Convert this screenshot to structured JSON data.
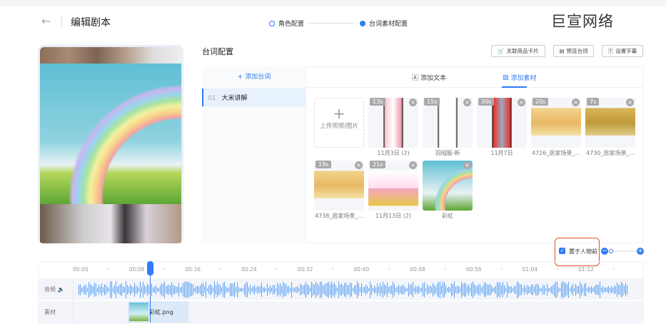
{
  "header": {
    "back_icon": "arrow-left-icon",
    "title": "编辑剧本",
    "steps": [
      "角色配置",
      "台词素材配置"
    ],
    "active_step": 1,
    "watermark": "巨宣网络"
  },
  "config": {
    "title": "台词配置",
    "buttons": [
      "关联商品卡片",
      "预览台词",
      "设置字幕"
    ],
    "add_line": "+ 添加台词",
    "tabs": [
      "添加文本",
      "添加素材"
    ],
    "active_tab": 1,
    "lines": [
      {
        "num": "01",
        "text": "大米讲解"
      }
    ],
    "upload_label": "上传视频/图片",
    "materials": [
      {
        "duration": "13s",
        "name": "11月3日 (2)",
        "thumb": "phone-pink"
      },
      {
        "duration": "15s",
        "name": "羽绒服-新",
        "thumb": "phone-blank"
      },
      {
        "duration": "30s",
        "name": "11月7日",
        "thumb": "phone-red"
      },
      {
        "duration": "20s",
        "name": "4726_居家场景_...",
        "thumb": "durian-flesh"
      },
      {
        "duration": "7s",
        "name": "4730_居家场景_...",
        "thumb": "durian"
      },
      {
        "duration": "19s",
        "name": "4738_居家场景_...",
        "thumb": "durian-flesh"
      },
      {
        "duration": "21s",
        "name": "11月13日 (2)",
        "thumb": "product"
      },
      {
        "duration": "",
        "name": "彩虹",
        "thumb": "rainbow"
      }
    ]
  },
  "options": {
    "in_front_label": "置于人物前",
    "in_front_checked": true,
    "zoom_level": 0
  },
  "timeline": {
    "ticks": [
      "00:00",
      "00:08",
      "00:16",
      "00:24",
      "00:32",
      "00:40",
      "00:48",
      "00:56",
      "01:04",
      "01:12"
    ],
    "playhead_seconds": 9,
    "audio_label": "音频",
    "material_label": "素材",
    "clip_name": "彩虹.png"
  },
  "colors": {
    "accent": "#2f7cf6",
    "highlight": "#e2502c"
  }
}
